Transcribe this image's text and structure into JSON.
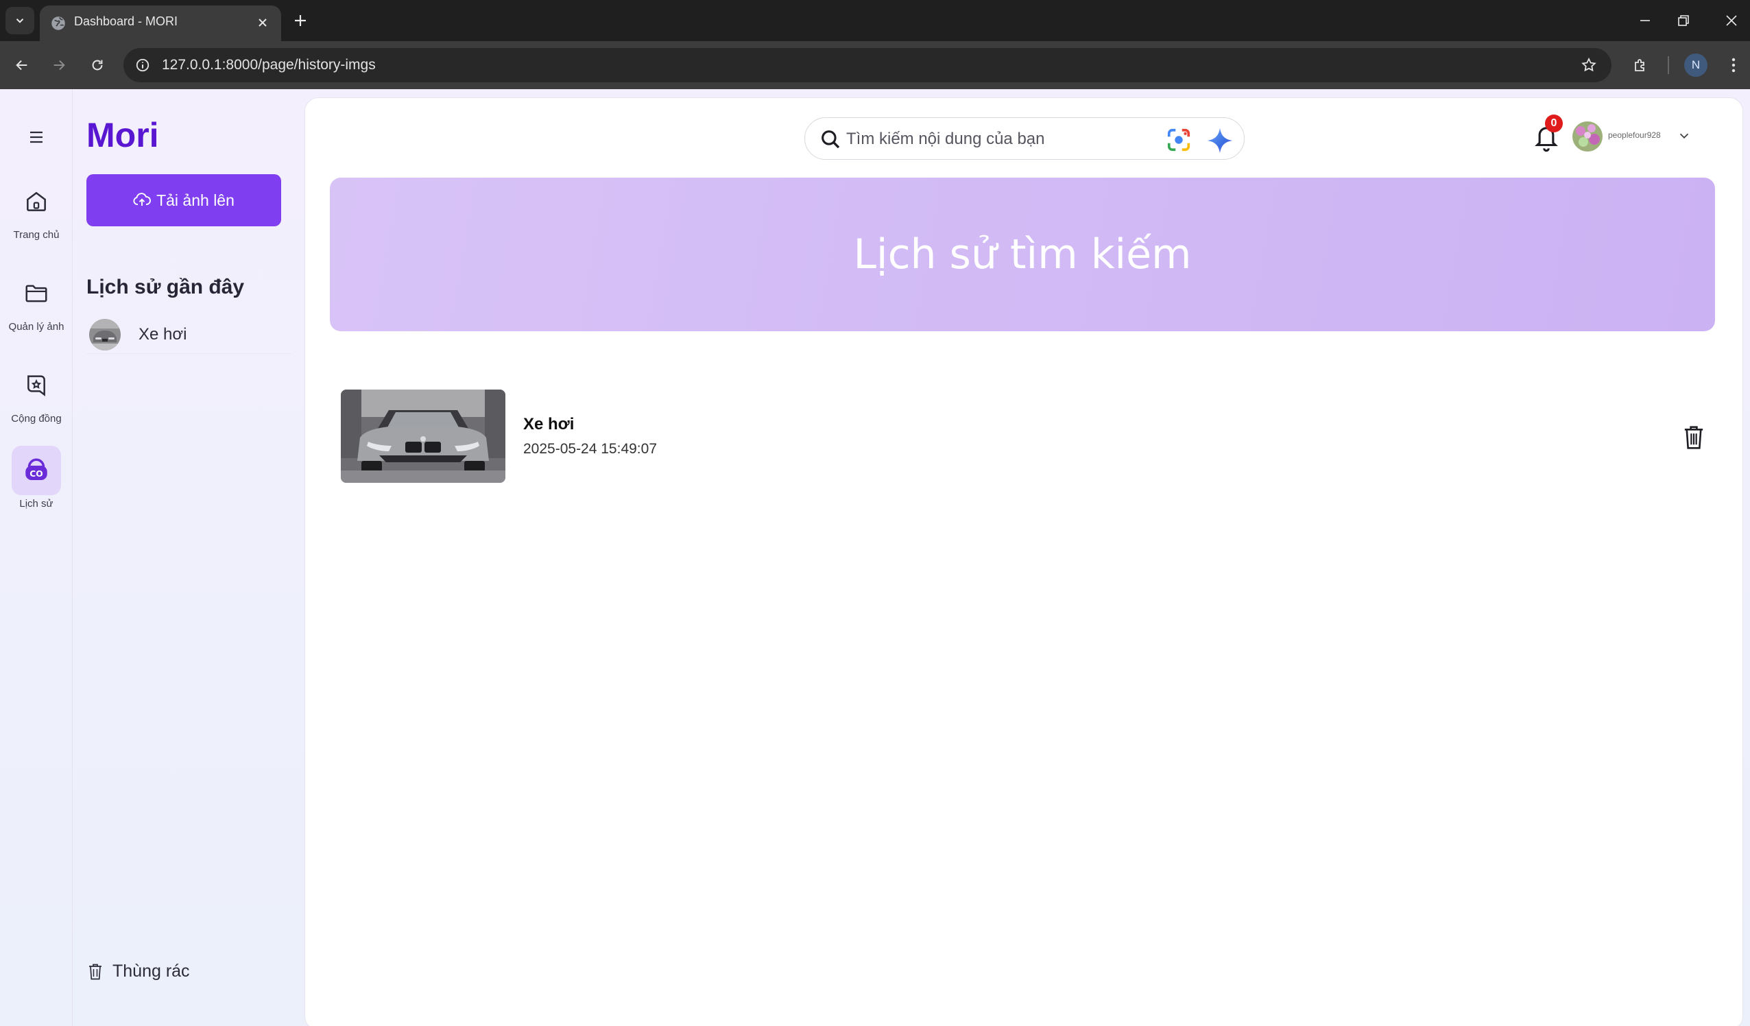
{
  "browser": {
    "tab_title": "Dashboard - MORI",
    "url": "127.0.0.1:8000/page/history-imgs",
    "profile_initial": "N"
  },
  "app": {
    "brand": "Mori",
    "upload_label": "Tải ảnh lên",
    "rail": [
      {
        "label": "Trang chủ",
        "icon": "home-icon"
      },
      {
        "label": "Quản lý ảnh",
        "icon": "folder-icon"
      },
      {
        "label": "Cộng đồng",
        "icon": "community-icon"
      },
      {
        "label": "Lịch sử",
        "icon": "history-icon",
        "active": true
      }
    ],
    "recent_title": "Lịch sử gần đây",
    "recent_items": [
      {
        "label": "Xe hơi"
      }
    ],
    "trash_label": "Thùng rác"
  },
  "header": {
    "search_placeholder": "Tìm kiếm nội dung của bạn",
    "notification_count": "0",
    "username": "peoplefour928"
  },
  "main": {
    "hero_title": "Lịch sử tìm kiếm",
    "history": [
      {
        "name": "Xe hơi",
        "date": "2025-05-24 15:49:07"
      }
    ]
  },
  "colors": {
    "brand": "#5a17d1",
    "primary_button": "#7f3ff0",
    "hero": "#d2bbf5",
    "badge": "#e01b1b"
  }
}
